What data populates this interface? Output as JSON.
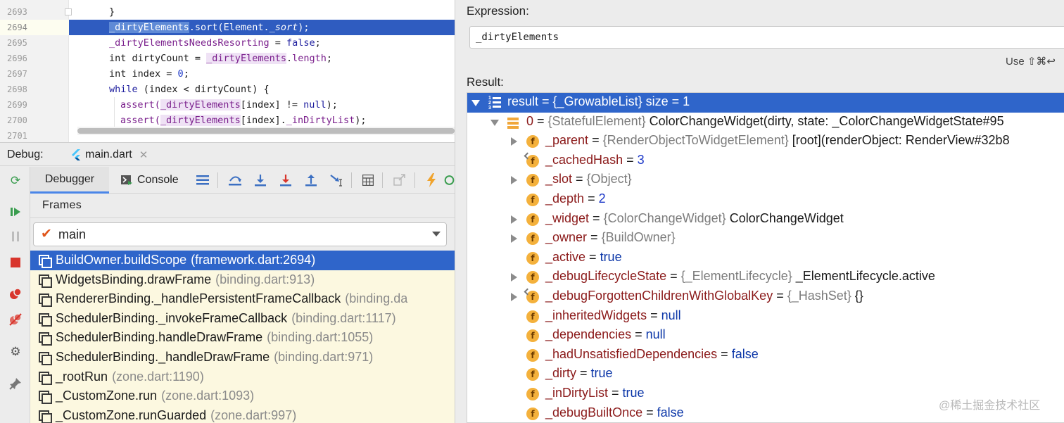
{
  "editor": {
    "lines": [
      {
        "num": "2693",
        "parts": [
          {
            "t": "}",
            "c": ""
          }
        ],
        "indent": 0,
        "fold": true
      },
      {
        "num": "2694",
        "exec": true,
        "parts": [
          {
            "t": "_dirtyElements",
            "c": "sel"
          },
          {
            "t": ".sort(Element.",
            "c": ""
          },
          {
            "t": "_sort",
            "c": "ital"
          },
          {
            "t": ");",
            "c": ""
          }
        ]
      },
      {
        "num": "2695",
        "parts": [
          {
            "t": "_dirtyElementsNeedsResorting",
            "c": "fld"
          },
          {
            "t": " = ",
            "c": ""
          },
          {
            "t": "false",
            "c": "kw"
          },
          {
            "t": ";",
            "c": ""
          }
        ]
      },
      {
        "num": "2696",
        "parts": [
          {
            "t": "int dirtyCount = ",
            "c": ""
          },
          {
            "t": "_dirtyElements",
            "c": "fld-bg"
          },
          {
            "t": ".",
            "c": ""
          },
          {
            "t": "length",
            "c": "fld"
          },
          {
            "t": ";",
            "c": ""
          }
        ]
      },
      {
        "num": "2697",
        "parts": [
          {
            "t": "int index = ",
            "c": ""
          },
          {
            "t": "0",
            "c": "num"
          },
          {
            "t": ";",
            "c": ""
          }
        ]
      },
      {
        "num": "2698",
        "parts": [
          {
            "t": "while",
            "c": "kw"
          },
          {
            "t": " (index < dirtyCount) {",
            "c": ""
          }
        ]
      },
      {
        "num": "2699",
        "indent": 1,
        "parts": [
          {
            "t": "assert(",
            "c": "fld"
          },
          {
            "t": "_dirtyElements",
            "c": "fld-bg"
          },
          {
            "t": "[index] != ",
            "c": ""
          },
          {
            "t": "null",
            "c": "kw"
          },
          {
            "t": ");",
            "c": ""
          }
        ]
      },
      {
        "num": "2700",
        "indent": 1,
        "parts": [
          {
            "t": "assert(",
            "c": "fld"
          },
          {
            "t": "_dirtyElements",
            "c": "fld-bg"
          },
          {
            "t": "[index].",
            "c": ""
          },
          {
            "t": "_inDirtyList",
            "c": "fld"
          },
          {
            "t": ");",
            "c": ""
          }
        ]
      },
      {
        "num": "2701",
        "parts": []
      }
    ]
  },
  "debug": {
    "label": "Debug:",
    "file_tab": "main.dart",
    "tabs": {
      "debugger": "Debugger",
      "console": "Console"
    },
    "frames_title": "Frames",
    "thread": "main",
    "frames": [
      {
        "name": "BuildOwner.buildScope",
        "loc": "(framework.dart:2694)"
      },
      {
        "name": "WidgetsBinding.drawFrame",
        "loc": "(binding.dart:913)"
      },
      {
        "name": "RendererBinding._handlePersistentFrameCallback",
        "loc": "(binding.da"
      },
      {
        "name": "SchedulerBinding._invokeFrameCallback",
        "loc": "(binding.dart:1117)"
      },
      {
        "name": "SchedulerBinding.handleDrawFrame",
        "loc": "(binding.dart:1055)"
      },
      {
        "name": "SchedulerBinding._handleDrawFrame",
        "loc": "(binding.dart:971)"
      },
      {
        "name": "_rootRun",
        "loc": "(zone.dart:1190)"
      },
      {
        "name": "_CustomZone.run",
        "loc": "(zone.dart:1093)"
      },
      {
        "name": "_CustomZone.runGuarded",
        "loc": "(zone.dart:997)"
      }
    ]
  },
  "evaluate": {
    "expression_label": "Expression:",
    "expression_value": "_dirtyElements",
    "use_hint": "Use ⇧⌘↩",
    "result_label": "Result:",
    "tree": [
      {
        "level": 0,
        "exp": "open",
        "icon": "list",
        "parts": [
          {
            "t": "result = {_GrowableList} size = 1",
            "c": "plain"
          }
        ]
      },
      {
        "level": 1,
        "exp": "open",
        "icon": "stack",
        "parts": [
          {
            "t": "0",
            "c": "name"
          },
          {
            "t": " = ",
            "c": "eq"
          },
          {
            "t": "{StatefulElement}",
            "c": "type"
          },
          {
            "t": " ColorChangeWidget(dirty, state: _ColorChangeWidgetState#95",
            "c": "plain"
          }
        ]
      },
      {
        "level": 2,
        "exp": "closed",
        "icon": "f",
        "parts": [
          {
            "t": "_parent",
            "c": "name"
          },
          {
            "t": " = ",
            "c": "eq"
          },
          {
            "t": "{RenderObjectToWidgetElement}",
            "c": "type"
          },
          {
            "t": " [root](renderObject: RenderView#32b8",
            "c": "plain"
          }
        ]
      },
      {
        "level": 2,
        "exp": "",
        "icon": "f",
        "pin": true,
        "parts": [
          {
            "t": "_cachedHash",
            "c": "name"
          },
          {
            "t": " = ",
            "c": "eq"
          },
          {
            "t": "3",
            "c": "num"
          }
        ]
      },
      {
        "level": 2,
        "exp": "closed",
        "icon": "f",
        "parts": [
          {
            "t": "_slot",
            "c": "name"
          },
          {
            "t": " = ",
            "c": "eq"
          },
          {
            "t": "{Object}",
            "c": "type"
          }
        ]
      },
      {
        "level": 2,
        "exp": "",
        "icon": "f",
        "parts": [
          {
            "t": "_depth",
            "c": "name"
          },
          {
            "t": " = ",
            "c": "eq"
          },
          {
            "t": "2",
            "c": "num"
          }
        ]
      },
      {
        "level": 2,
        "exp": "closed",
        "icon": "f",
        "parts": [
          {
            "t": "_widget",
            "c": "name"
          },
          {
            "t": " = ",
            "c": "eq"
          },
          {
            "t": "{ColorChangeWidget}",
            "c": "type"
          },
          {
            "t": " ColorChangeWidget",
            "c": "plain"
          }
        ]
      },
      {
        "level": 2,
        "exp": "closed",
        "icon": "f",
        "parts": [
          {
            "t": "_owner",
            "c": "name"
          },
          {
            "t": " = ",
            "c": "eq"
          },
          {
            "t": "{BuildOwner}",
            "c": "type"
          }
        ]
      },
      {
        "level": 2,
        "exp": "",
        "icon": "f",
        "parts": [
          {
            "t": "_active",
            "c": "name"
          },
          {
            "t": " = ",
            "c": "eq"
          },
          {
            "t": "true",
            "c": "kw"
          }
        ]
      },
      {
        "level": 2,
        "exp": "closed",
        "icon": "f",
        "parts": [
          {
            "t": "_debugLifecycleState",
            "c": "name"
          },
          {
            "t": " = ",
            "c": "eq"
          },
          {
            "t": "{_ElementLifecycle}",
            "c": "type"
          },
          {
            "t": " _ElementLifecycle.active",
            "c": "plain"
          }
        ]
      },
      {
        "level": 2,
        "exp": "closed",
        "icon": "f",
        "pin": true,
        "parts": [
          {
            "t": "_debugForgottenChildrenWithGlobalKey",
            "c": "name"
          },
          {
            "t": " = ",
            "c": "eq"
          },
          {
            "t": "{_HashSet}",
            "c": "type"
          },
          {
            "t": " {}",
            "c": "plain"
          }
        ]
      },
      {
        "level": 2,
        "exp": "",
        "icon": "f",
        "parts": [
          {
            "t": "_inheritedWidgets",
            "c": "name"
          },
          {
            "t": " = ",
            "c": "eq"
          },
          {
            "t": "null",
            "c": "kw"
          }
        ]
      },
      {
        "level": 2,
        "exp": "",
        "icon": "f",
        "parts": [
          {
            "t": "_dependencies",
            "c": "name"
          },
          {
            "t": " = ",
            "c": "eq"
          },
          {
            "t": "null",
            "c": "kw"
          }
        ]
      },
      {
        "level": 2,
        "exp": "",
        "icon": "f",
        "parts": [
          {
            "t": "_hadUnsatisfiedDependencies",
            "c": "name"
          },
          {
            "t": " = ",
            "c": "eq"
          },
          {
            "t": "false",
            "c": "kw"
          }
        ]
      },
      {
        "level": 2,
        "exp": "",
        "icon": "f",
        "parts": [
          {
            "t": "_dirty",
            "c": "name"
          },
          {
            "t": " = ",
            "c": "eq"
          },
          {
            "t": "true",
            "c": "kw"
          }
        ]
      },
      {
        "level": 2,
        "exp": "",
        "icon": "f",
        "parts": [
          {
            "t": "_inDirtyList",
            "c": "name"
          },
          {
            "t": " = ",
            "c": "eq"
          },
          {
            "t": "true",
            "c": "kw"
          }
        ]
      },
      {
        "level": 2,
        "exp": "",
        "icon": "f",
        "parts": [
          {
            "t": "_debugBuiltOnce",
            "c": "name"
          },
          {
            "t": " = ",
            "c": "eq"
          },
          {
            "t": "false",
            "c": "kw"
          }
        ]
      }
    ]
  },
  "watermark": "@稀土掘金技术社区"
}
